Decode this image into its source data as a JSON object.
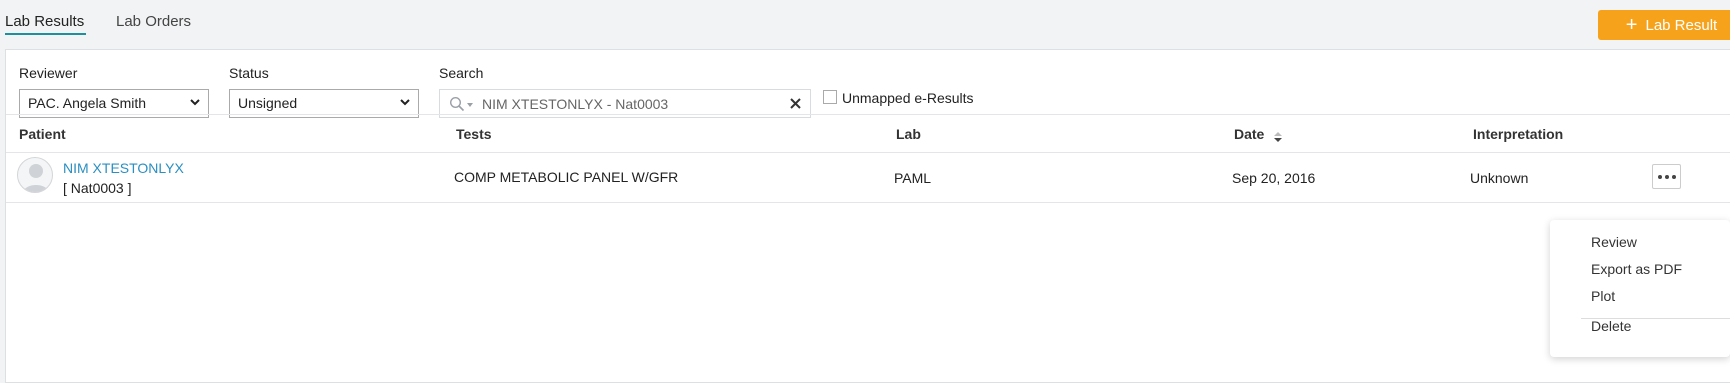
{
  "tabs": {
    "results": "Lab Results",
    "orders": "Lab Orders"
  },
  "add_button": {
    "label": "Lab Result",
    "color": "#f7a21b"
  },
  "filters": {
    "reviewer_label": "Reviewer",
    "reviewer_value": "PAC. Angela Smith",
    "status_label": "Status",
    "status_value": "Unsigned",
    "search_label": "Search",
    "search_value": "NIM XTESTONLYX - Nat0003",
    "unmapped_label": "Unmapped e-Results",
    "unmapped_checked": false
  },
  "table": {
    "headers": {
      "patient": "Patient",
      "tests": "Tests",
      "lab": "Lab",
      "date": "Date",
      "interpretation": "Interpretation"
    },
    "rows": [
      {
        "patient_name": "NIM XTESTONLYX",
        "patient_id": "[ Nat0003 ]",
        "tests": "COMP METABOLIC PANEL W/GFR",
        "lab": "PAML",
        "date": "Sep 20, 2016",
        "interpretation": "Unknown"
      }
    ]
  },
  "context_menu": {
    "items": [
      "Review",
      "Export as PDF",
      "Plot",
      "Delete"
    ]
  },
  "colors": {
    "accent": "#1f8f9d",
    "link": "#2a8fc1"
  }
}
